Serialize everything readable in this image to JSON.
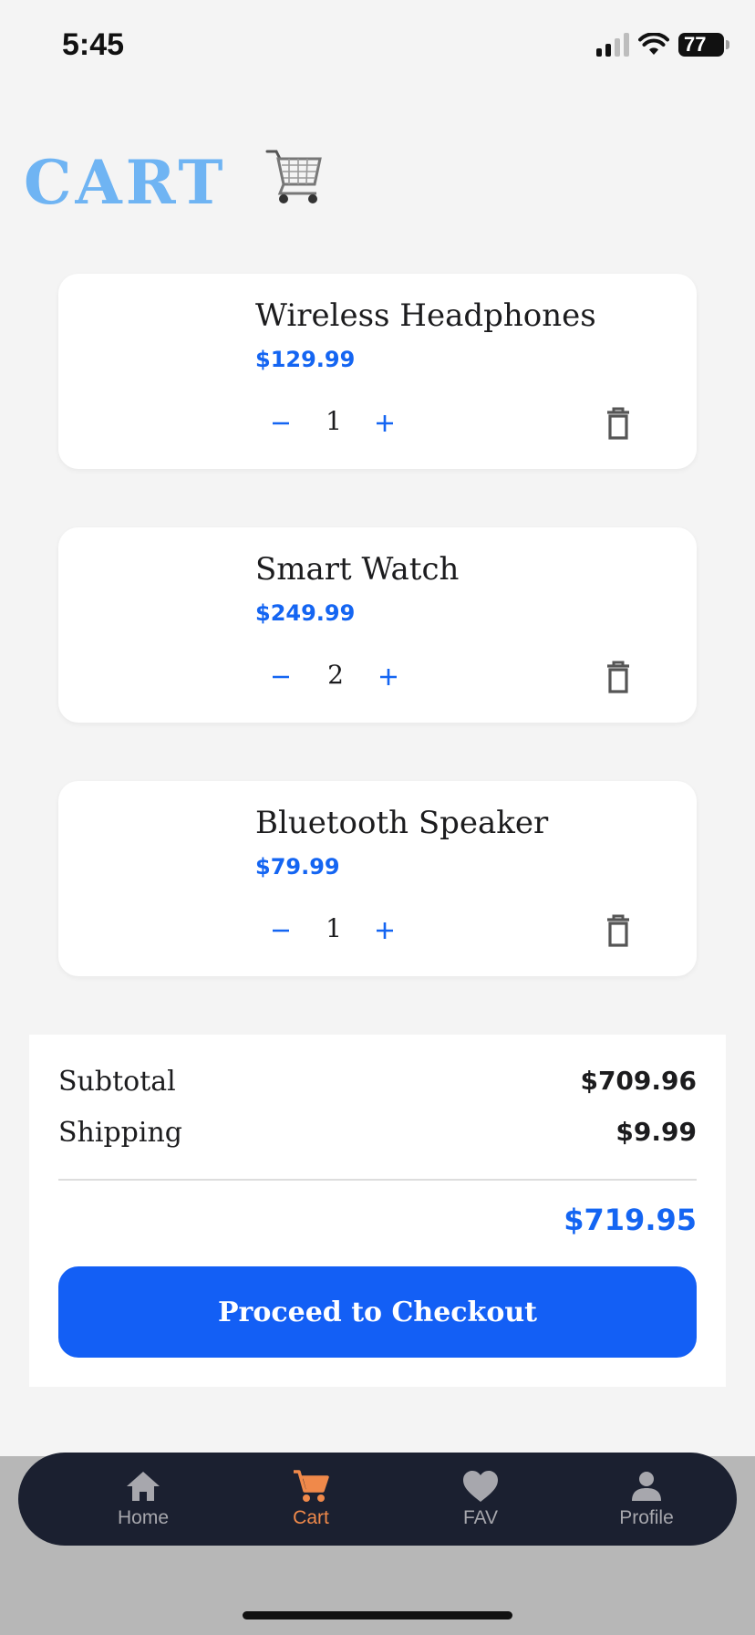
{
  "status_bar": {
    "time": "5:45",
    "battery": "77"
  },
  "page": {
    "title": "CART"
  },
  "cart": {
    "items": [
      {
        "name": "Wireless Headphones",
        "price": "$129.99",
        "quantity": "1"
      },
      {
        "name": "Smart Watch",
        "price": "$249.99",
        "quantity": "2"
      },
      {
        "name": "Bluetooth Speaker",
        "price": "$79.99",
        "quantity": "1"
      }
    ]
  },
  "summary": {
    "subtotal_label": "Subtotal",
    "subtotal_value": "$709.96",
    "shipping_label": "Shipping",
    "shipping_value": "$9.99",
    "total_value": "$719.95",
    "checkout_label": "Proceed to Checkout"
  },
  "nav": {
    "tabs": [
      {
        "label": "Home",
        "icon": "home-icon"
      },
      {
        "label": "Cart",
        "icon": "cart-icon",
        "active": true
      },
      {
        "label": "FAV",
        "icon": "heart-icon"
      },
      {
        "label": "Profile",
        "icon": "person-icon"
      }
    ]
  },
  "colors": {
    "accent_blue": "#1465f2",
    "title_blue": "#6fb4f3",
    "nav_bg": "#1b2030",
    "nav_active": "#f0894a",
    "nav_inactive": "#a7a7ad"
  }
}
